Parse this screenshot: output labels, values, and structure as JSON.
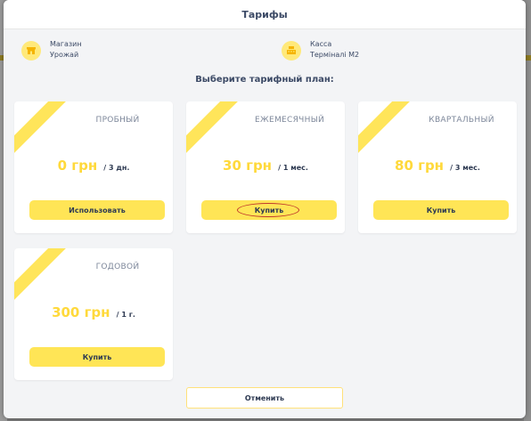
{
  "dialog": {
    "title": "Тарифы",
    "subtitle": "Выберите тарифный план:",
    "cancel_label": "Отменить"
  },
  "store": {
    "label": "Магазин",
    "value": "Урожай",
    "icon": "store-icon"
  },
  "register": {
    "label": "Касса",
    "value": "Терміналі М2",
    "icon": "cash-register-icon"
  },
  "plans": [
    {
      "name": "ПРОБНЫЙ",
      "price": "0 грн",
      "period": "/ 3 дн.",
      "button": "Использовать"
    },
    {
      "name": "ЕЖЕМЕСЯЧНЫЙ",
      "price": "30 грн",
      "period": "/ 1 мес.",
      "button": "Купить"
    },
    {
      "name": "КВАРТАЛЬНЫЙ",
      "price": "80 грн",
      "period": "/ 3 мес.",
      "button": "Купить"
    },
    {
      "name": "ГОДОВОЙ",
      "price": "300 грн",
      "period": "/ 1 г.",
      "button": "Купить"
    }
  ],
  "colors": {
    "accent": "#ffe556",
    "price": "#ffd93b",
    "text": "#2e3a52",
    "highlight": "#c0392b"
  }
}
